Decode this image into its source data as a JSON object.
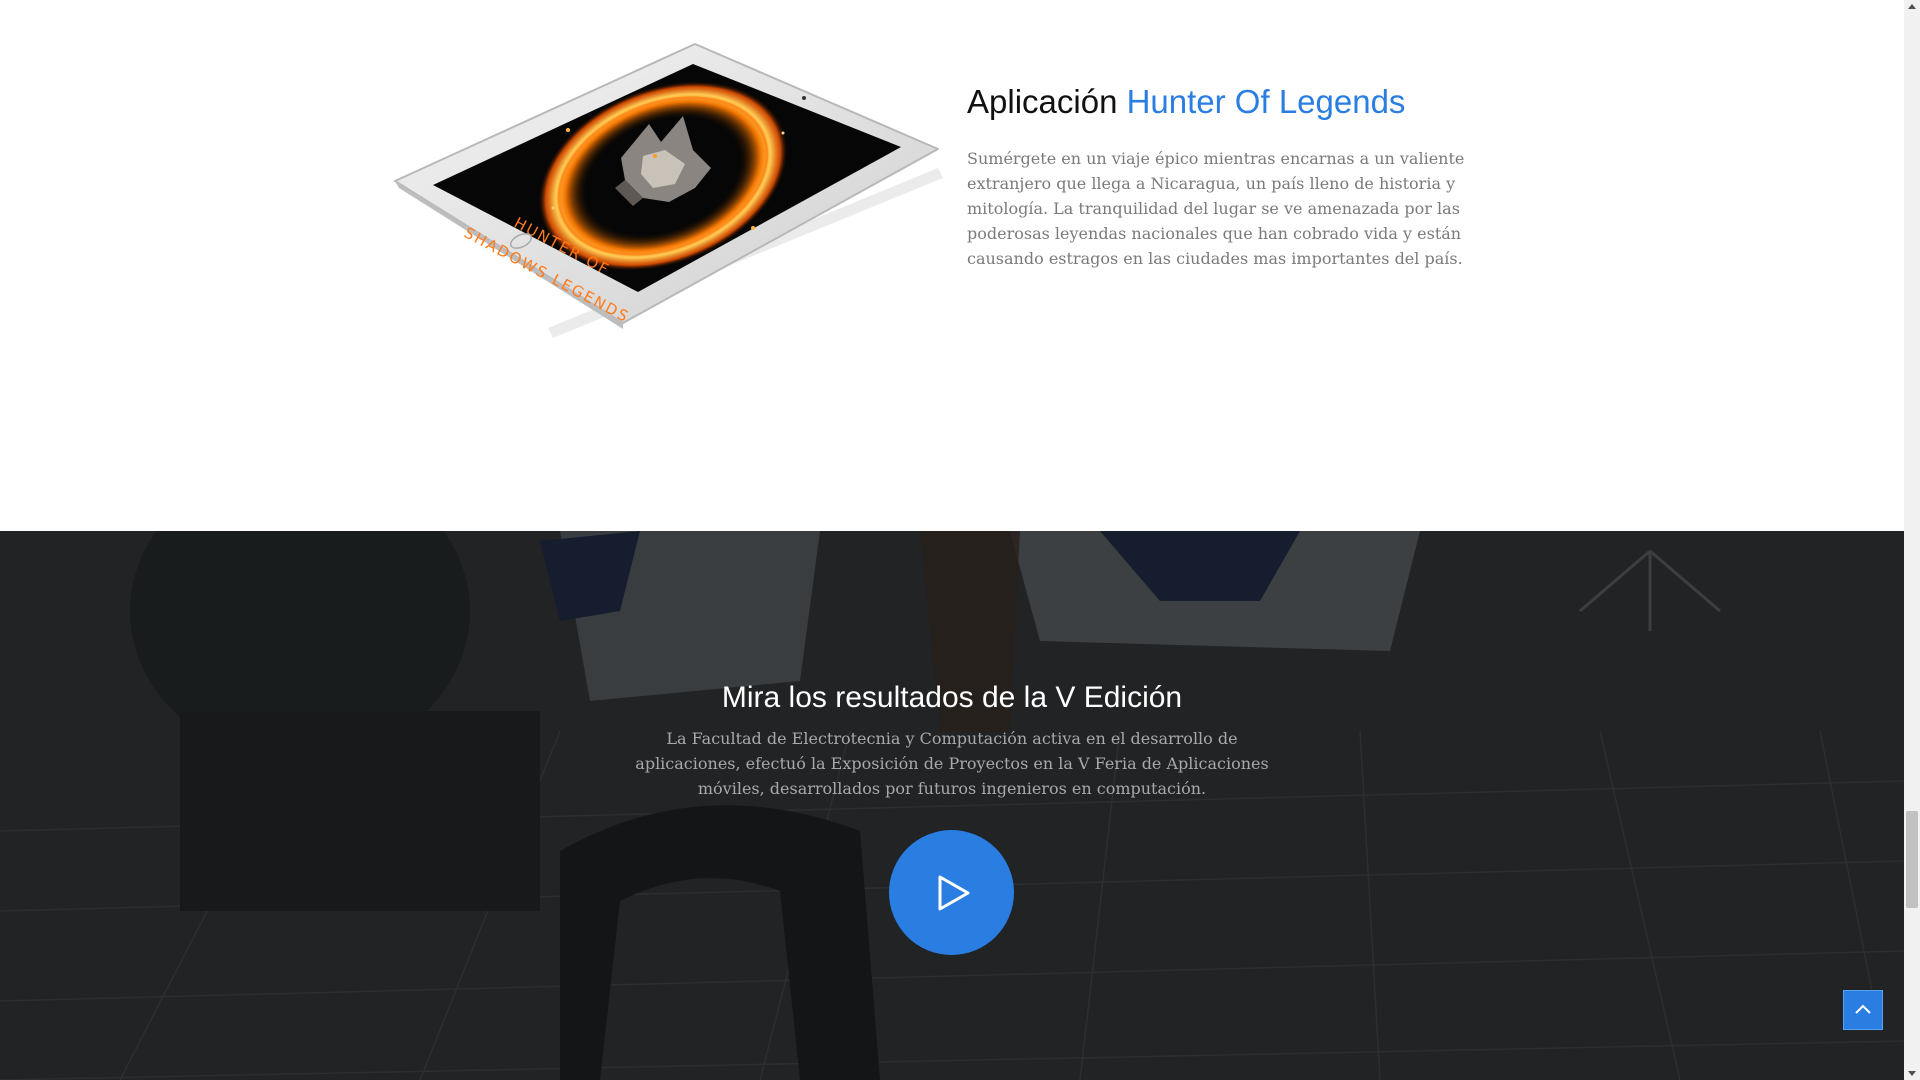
{
  "feature": {
    "title_prefix": "Aplicación",
    "title_accent": "Hunter Of Legends",
    "description": "Sumérgete en un viaje épico mientras encarnas a un valiente extranjero que llega a Nicaragua, un país lleno de historia y mitología. La tranquilidad del lugar se ve amenazada por las poderosas leyendas nacionales que han cobrado vida y están causando estragos en las ciudades mas importantes del país.",
    "tablet_screen_text_line1": "HUNTER OF",
    "tablet_screen_text_line2": "SHADOWS LEGENDS"
  },
  "results": {
    "title": "Mira los resultados de la V Edición",
    "description": "La Facultad de Electrotecnia y Computación activa en el desarrollo de aplicaciones, efectuó la Exposición de Proyectos en la V Feria de Aplicaciones móviles, desarrollados por futuros ingenieros en computación.",
    "play_icon": "play-icon"
  },
  "scroll_top": {
    "icon": "chevron-up-icon"
  },
  "colors": {
    "accent": "#2a7de1",
    "heading": "#111111",
    "body_text": "#7a7a7a",
    "dark_section": "#2b2c2e"
  }
}
